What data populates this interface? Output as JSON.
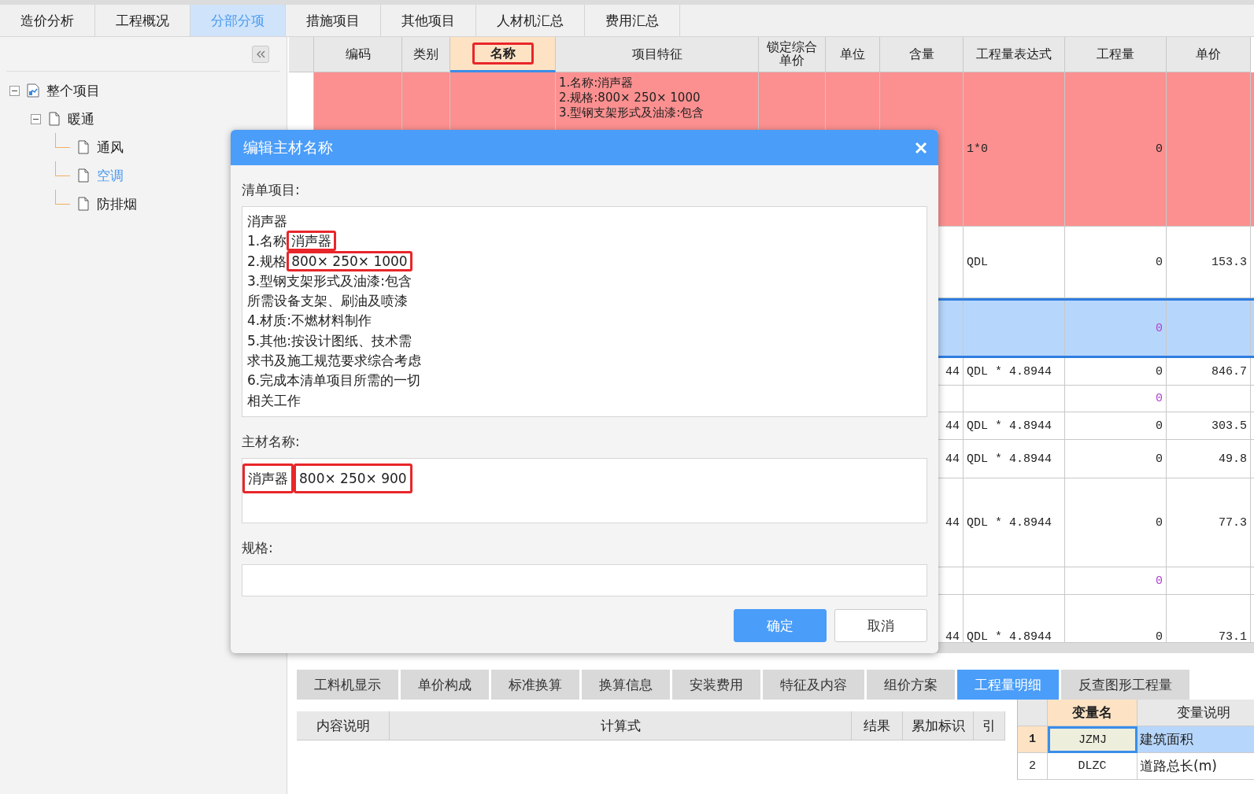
{
  "tabs": [
    {
      "label": "造价分析",
      "selected": false
    },
    {
      "label": "工程概况",
      "selected": false
    },
    {
      "label": "分部分项",
      "selected": true
    },
    {
      "label": "措施项目",
      "selected": false
    },
    {
      "label": "其他项目",
      "selected": false
    },
    {
      "label": "人材机汇总",
      "selected": false
    },
    {
      "label": "费用汇总",
      "selected": false
    }
  ],
  "tree": {
    "items": [
      {
        "label": "整个项目",
        "kind": "project",
        "expanded": true,
        "selected": false,
        "children": [
          {
            "label": "暖通",
            "kind": "folder",
            "expanded": true,
            "selected": false,
            "children": [
              {
                "label": "通风",
                "kind": "leaf",
                "selected": false
              },
              {
                "label": "空调",
                "kind": "leaf",
                "selected": true
              },
              {
                "label": "防排烟",
                "kind": "leaf",
                "selected": false
              }
            ]
          }
        ]
      }
    ]
  },
  "grid": {
    "columns": [
      {
        "label": "编码",
        "selected": false
      },
      {
        "label": "类别",
        "selected": false
      },
      {
        "label": "名称",
        "selected": true,
        "highlighted": true
      },
      {
        "label": "项目特征",
        "selected": false
      },
      {
        "label": "锁定综合单价",
        "selected": false
      },
      {
        "label": "单位",
        "selected": false
      },
      {
        "label": "含量",
        "selected": false
      },
      {
        "label": "工程量表达式",
        "selected": false
      },
      {
        "label": "工程量",
        "selected": false
      },
      {
        "label": "单价",
        "selected": false
      }
    ],
    "rows": [
      {
        "kind": "flagged",
        "selected": false,
        "feature": [
          "1.名称:消声器",
          "2.规格:800× 250× 1000",
          "3.型钢支架形式及油漆:包含"
        ],
        "expression": "1*0",
        "quantity": "0"
      },
      {
        "kind": "item",
        "selected": false,
        "expression": "QDL",
        "quantity": "0",
        "unit_price": "153.3"
      },
      {
        "kind": "sub",
        "selected": true,
        "quantity": "0"
      },
      {
        "kind": "item",
        "selected": false,
        "content": "44",
        "expression": "QDL * 4.8944",
        "quantity": "0",
        "unit_price": "846.7"
      },
      {
        "kind": "sub",
        "selected": false,
        "quantity": "0"
      },
      {
        "kind": "item",
        "selected": false,
        "content": "44",
        "expression": "QDL * 4.8944",
        "quantity": "0",
        "unit_price": "303.5"
      },
      {
        "kind": "item",
        "selected": false,
        "content": "44",
        "expression": "QDL * 4.8944",
        "quantity": "0",
        "unit_price": "49.8"
      },
      {
        "kind": "item",
        "selected": false,
        "content": "44",
        "expression": "QDL * 4.8944",
        "quantity": "0",
        "unit_price": "77.3"
      },
      {
        "kind": "sub",
        "selected": false,
        "quantity": "0"
      },
      {
        "kind": "item",
        "selected": false,
        "content": "44",
        "expression": "QDL * 4.8944",
        "quantity": "0",
        "unit_price": "73.1"
      }
    ]
  },
  "bottom_tabs": [
    {
      "label": "工料机显示",
      "selected": false
    },
    {
      "label": "单价构成",
      "selected": false
    },
    {
      "label": "标准换算",
      "selected": false
    },
    {
      "label": "换算信息",
      "selected": false
    },
    {
      "label": "安装费用",
      "selected": false
    },
    {
      "label": "特征及内容",
      "selected": false
    },
    {
      "label": "组价方案",
      "selected": false
    },
    {
      "label": "工程量明细",
      "selected": true
    },
    {
      "label": "反查图形工程量",
      "selected": false
    }
  ],
  "detail_table": {
    "columns": [
      "内容说明",
      "计算式",
      "结果",
      "累加标识",
      "引"
    ]
  },
  "variables": {
    "columns": [
      {
        "label": "变量名",
        "selected": true
      },
      {
        "label": "变量说明",
        "selected": false
      }
    ],
    "rows": [
      {
        "index": "1",
        "name": "JZMJ",
        "description": "建筑面积",
        "selected": true
      },
      {
        "index": "2",
        "name": "DLZC",
        "description": "道路总长(m)",
        "selected": false
      }
    ]
  },
  "dialog": {
    "title": "编辑主材名称",
    "bill_label": "清单项目:",
    "bill_lines": [
      [
        {
          "text": "消声器"
        }
      ],
      [
        {
          "text": "1.名称"
        },
        {
          "text": "消声器",
          "highlighted": true
        }
      ],
      [
        {
          "text": "2.规格"
        },
        {
          "text": "800× 250× 1000",
          "highlighted": true
        }
      ],
      [
        {
          "text": "3.型钢支架形式及油漆:包含"
        }
      ],
      [
        {
          "text": "所需设备支架、刷油及喷漆"
        }
      ],
      [
        {
          "text": "4.材质:不燃材料制作"
        }
      ],
      [
        {
          "text": "5.其他:按设计图纸、技术需"
        }
      ],
      [
        {
          "text": "求书及施工规范要求综合考虑"
        }
      ],
      [
        {
          "text": "6.完成本清单项目所需的一切"
        }
      ],
      [
        {
          "text": "相关工作"
        }
      ]
    ],
    "material_label": "主材名称:",
    "material_value": [
      {
        "text": "消声器",
        "highlighted": true
      },
      {
        "text": "800× 250× 900",
        "highlighted": true
      }
    ],
    "spec_label": "规格:",
    "buttons": [
      {
        "label": "确定",
        "kind": "primary"
      },
      {
        "label": "取消",
        "kind": "secondary"
      }
    ]
  }
}
